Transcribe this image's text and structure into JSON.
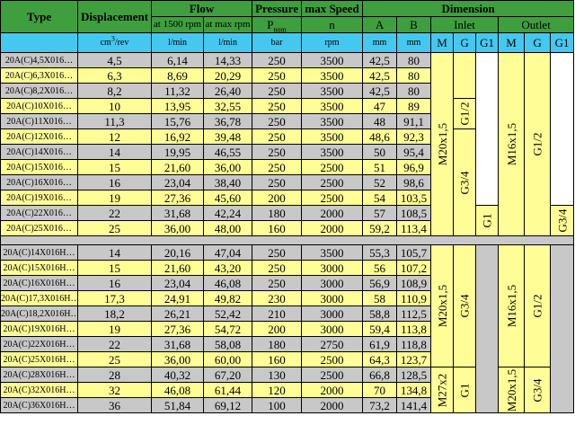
{
  "headers": {
    "type": "Type",
    "displacement": "Displacement",
    "flow": "Flow",
    "pressure": "Pressure",
    "max_speed": "max Speed",
    "dimension": "Dimension",
    "flow_1500": "at 1500 rpm",
    "flow_max": "at max rpm",
    "p_base": "P",
    "p_sub": "nom",
    "speed_sym": "n",
    "col_a": "A",
    "col_b": "B",
    "inlet": "Inlet",
    "outlet": "Outlet",
    "in_m": "M",
    "in_g": "G",
    "in_g1": "G1",
    "out_m": "M",
    "out_g": "G",
    "out_g1": "G1",
    "u_disp_base": "cm",
    "u_disp_sup": "3",
    "u_disp_rest": "/rev",
    "u_flow1": "l/min",
    "u_flow2": "l/min",
    "u_pressure": "bar",
    "u_speed": "rpm",
    "u_a": "mm",
    "u_b": "mm"
  },
  "group1": [
    {
      "type": "20A(C)4,5X016…",
      "disp": "4,5",
      "flow1500": "6,14",
      "flowmax": "14,33",
      "pressure": "250",
      "speed": "3500",
      "a": "42,5",
      "b": "80"
    },
    {
      "type": "20A(C)6,3X016…",
      "disp": "6,3",
      "flow1500": "8,69",
      "flowmax": "20,29",
      "pressure": "250",
      "speed": "3500",
      "a": "42,5",
      "b": "80"
    },
    {
      "type": "20A(C)8,2X016…",
      "disp": "8,2",
      "flow1500": "11,32",
      "flowmax": "26,40",
      "pressure": "250",
      "speed": "3500",
      "a": "42,5",
      "b": "80"
    },
    {
      "type": "20A(C)10X016…",
      "disp": "10",
      "flow1500": "13,95",
      "flowmax": "32,55",
      "pressure": "250",
      "speed": "3500",
      "a": "47",
      "b": "89"
    },
    {
      "type": "20A(C)11X016…",
      "disp": "11,3",
      "flow1500": "15,76",
      "flowmax": "36,78",
      "pressure": "250",
      "speed": "3500",
      "a": "48",
      "b": "91,1"
    },
    {
      "type": "20A(C)12X016…",
      "disp": "12",
      "flow1500": "16,92",
      "flowmax": "39,48",
      "pressure": "250",
      "speed": "3500",
      "a": "48,6",
      "b": "92,3"
    },
    {
      "type": "20A(C)14X016…",
      "disp": "14",
      "flow1500": "19,95",
      "flowmax": "46,55",
      "pressure": "250",
      "speed": "3500",
      "a": "50",
      "b": "95,4"
    },
    {
      "type": "20A(C)15X016…",
      "disp": "15",
      "flow1500": "21,60",
      "flowmax": "36,00",
      "pressure": "250",
      "speed": "2500",
      "a": "51",
      "b": "96,9"
    },
    {
      "type": "20A(C)16X016…",
      "disp": "16",
      "flow1500": "23,04",
      "flowmax": "38,40",
      "pressure": "250",
      "speed": "2500",
      "a": "52",
      "b": "98,6"
    },
    {
      "type": "20A(C)19X016…",
      "disp": "19",
      "flow1500": "27,36",
      "flowmax": "45,60",
      "pressure": "200",
      "speed": "2500",
      "a": "54",
      "b": "103,5"
    },
    {
      "type": "20A(C)22X016…",
      "disp": "22",
      "flow1500": "31,68",
      "flowmax": "42,24",
      "pressure": "180",
      "speed": "2000",
      "a": "57",
      "b": "108,5"
    },
    {
      "type": "20A(C)25X016…",
      "disp": "25",
      "flow1500": "36,00",
      "flowmax": "48,00",
      "pressure": "160",
      "speed": "2000",
      "a": "59,2",
      "b": "113,4"
    }
  ],
  "group2": [
    {
      "type": "20A(C)14X016H…",
      "disp": "14",
      "flow1500": "20,16",
      "flowmax": "47,04",
      "pressure": "250",
      "speed": "3500",
      "a": "55,3",
      "b": "105,7"
    },
    {
      "type": "20A(C)15X016H…",
      "disp": "15",
      "flow1500": "21,60",
      "flowmax": "43,20",
      "pressure": "250",
      "speed": "3000",
      "a": "56",
      "b": "107,2"
    },
    {
      "type": "20A(C)16X016H…",
      "disp": "16",
      "flow1500": "23,04",
      "flowmax": "46,08",
      "pressure": "250",
      "speed": "3000",
      "a": "56,9",
      "b": "108,9"
    },
    {
      "type": "20A(C)17,3X016H…",
      "disp": "17,3",
      "flow1500": "24,91",
      "flowmax": "49,82",
      "pressure": "230",
      "speed": "3000",
      "a": "58",
      "b": "110,9"
    },
    {
      "type": "20A(C)18,2X016H…",
      "disp": "18,2",
      "flow1500": "26,21",
      "flowmax": "52,42",
      "pressure": "210",
      "speed": "3000",
      "a": "58,8",
      "b": "112,5"
    },
    {
      "type": "20A(C)19X016H…",
      "disp": "19",
      "flow1500": "27,36",
      "flowmax": "54,72",
      "pressure": "200",
      "speed": "3000",
      "a": "59,4",
      "b": "113,8"
    },
    {
      "type": "20A(C)22X016H…",
      "disp": "22",
      "flow1500": "31,68",
      "flowmax": "58,08",
      "pressure": "180",
      "speed": "2750",
      "a": "61,9",
      "b": "118,8"
    },
    {
      "type": "20A(C)25X016H…",
      "disp": "25",
      "flow1500": "36,00",
      "flowmax": "60,00",
      "pressure": "160",
      "speed": "2500",
      "a": "64,3",
      "b": "123,7"
    },
    {
      "type": "20A(C)28X016H…",
      "disp": "28",
      "flow1500": "40,32",
      "flowmax": "67,20",
      "pressure": "130",
      "speed": "2500",
      "a": "66,8",
      "b": "128,5"
    },
    {
      "type": "20A(C)32X016H…",
      "disp": "32",
      "flow1500": "46,08",
      "flowmax": "61,44",
      "pressure": "120",
      "speed": "2000",
      "a": "70",
      "b": "134,8"
    },
    {
      "type": "20A(C)36X016H…",
      "disp": "36",
      "flow1500": "51,84",
      "flowmax": "69,12",
      "pressure": "100",
      "speed": "2000",
      "a": "73,2",
      "b": "141,4"
    }
  ],
  "ports": {
    "g1_in_m": "M20x1,5",
    "g1_in_g_top": "G1/2",
    "g1_in_g_mid": "G3/4",
    "g1_in_g1": "G1",
    "g1_out_m_top": "M16x1,5",
    "g1_out_m_bot": "M20X1,5",
    "g1_out_g_top": "G1/2",
    "g1_out_g_bot": "G3/4",
    "g2_in_m_top": "M20x1,5",
    "g2_in_m_bot": "M27x2",
    "g2_in_g_top": "G3/4",
    "g2_in_g_bot": "G1",
    "g2_out_m_top": "M16x1,5",
    "g2_out_m_bot": "M20x1,5",
    "g2_out_g_top": "G1/2",
    "g2_out_g_bot": "G3/4"
  },
  "colors": {
    "header_green": "#3f9f3f",
    "header_cyan": "#45c8f0",
    "row_yellow": "#fffe96",
    "row_gray": "#c8c8c8"
  }
}
